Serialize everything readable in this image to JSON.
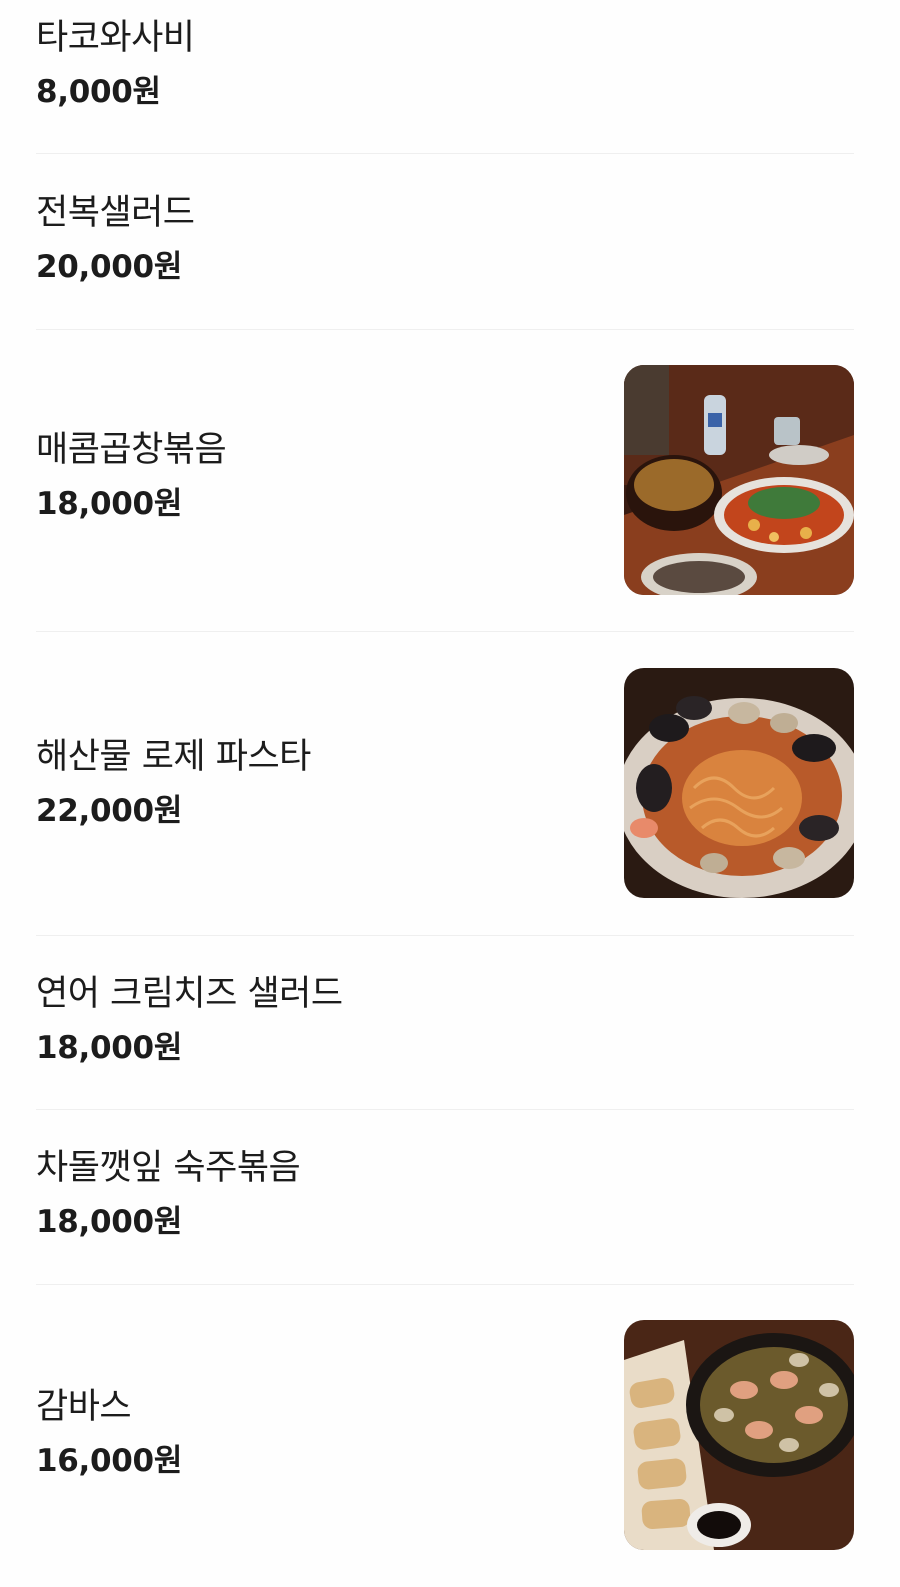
{
  "menu": {
    "items": [
      {
        "name": "타코와사비",
        "price": "8,000원"
      },
      {
        "name": "전복샐러드",
        "price": "20,000원"
      },
      {
        "name": "매콤곱창볶음",
        "price": "18,000원",
        "photo": "food-photo-spicy-gopchang"
      },
      {
        "name": "해산물 로제 파스타",
        "price": "22,000원",
        "photo": "food-photo-seafood-rose-pasta"
      },
      {
        "name": "연어 크림치즈 샐러드",
        "price": "18,000원"
      },
      {
        "name": "차돌깻잎 숙주볶음",
        "price": "18,000원"
      },
      {
        "name": "감바스",
        "price": "16,000원",
        "photo": "food-photo-gambas"
      }
    ]
  },
  "colors": {
    "background": "#fefefe",
    "text": "#1c1c1c",
    "divider": "#efefef"
  }
}
